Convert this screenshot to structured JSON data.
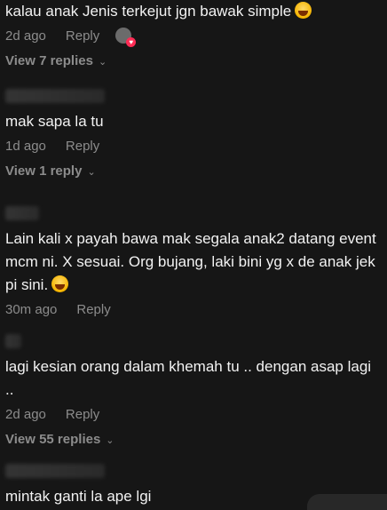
{
  "comments": [
    {
      "text": "kalau anak Jenis terkejut jgn bawak simple",
      "emoji": "laughing-emoji",
      "time": "2d ago",
      "reply_label": "Reply",
      "view_replies": "View 7 replies"
    },
    {
      "text": "mak sapa la tu",
      "time": "1d ago",
      "reply_label": "Reply",
      "view_replies": "View 1 reply"
    },
    {
      "text": "Lain kali x payah bawa mak segala anak2 datang event mcm ni. X sesuai. Org bujang, laki bini yg x de anak jek pi sini.",
      "emoji": "laughing-emoji",
      "time": "30m ago",
      "reply_label": "Reply"
    },
    {
      "text": "lagi kesian orang dalam khemah tu .. dengan asap lagi ..",
      "time": "2d ago",
      "reply_label": "Reply",
      "view_replies": "View 55 replies"
    },
    {
      "text": "mintak ganti la ape lgi"
    }
  ],
  "icons": {
    "chevron": "chevron-down-icon",
    "creator_like": "creator-liked-avatar-icon"
  },
  "colors": {
    "background": "#161616",
    "text": "#f2f2f2",
    "muted": "#8c8c8c",
    "accent": "#fe2c55"
  }
}
